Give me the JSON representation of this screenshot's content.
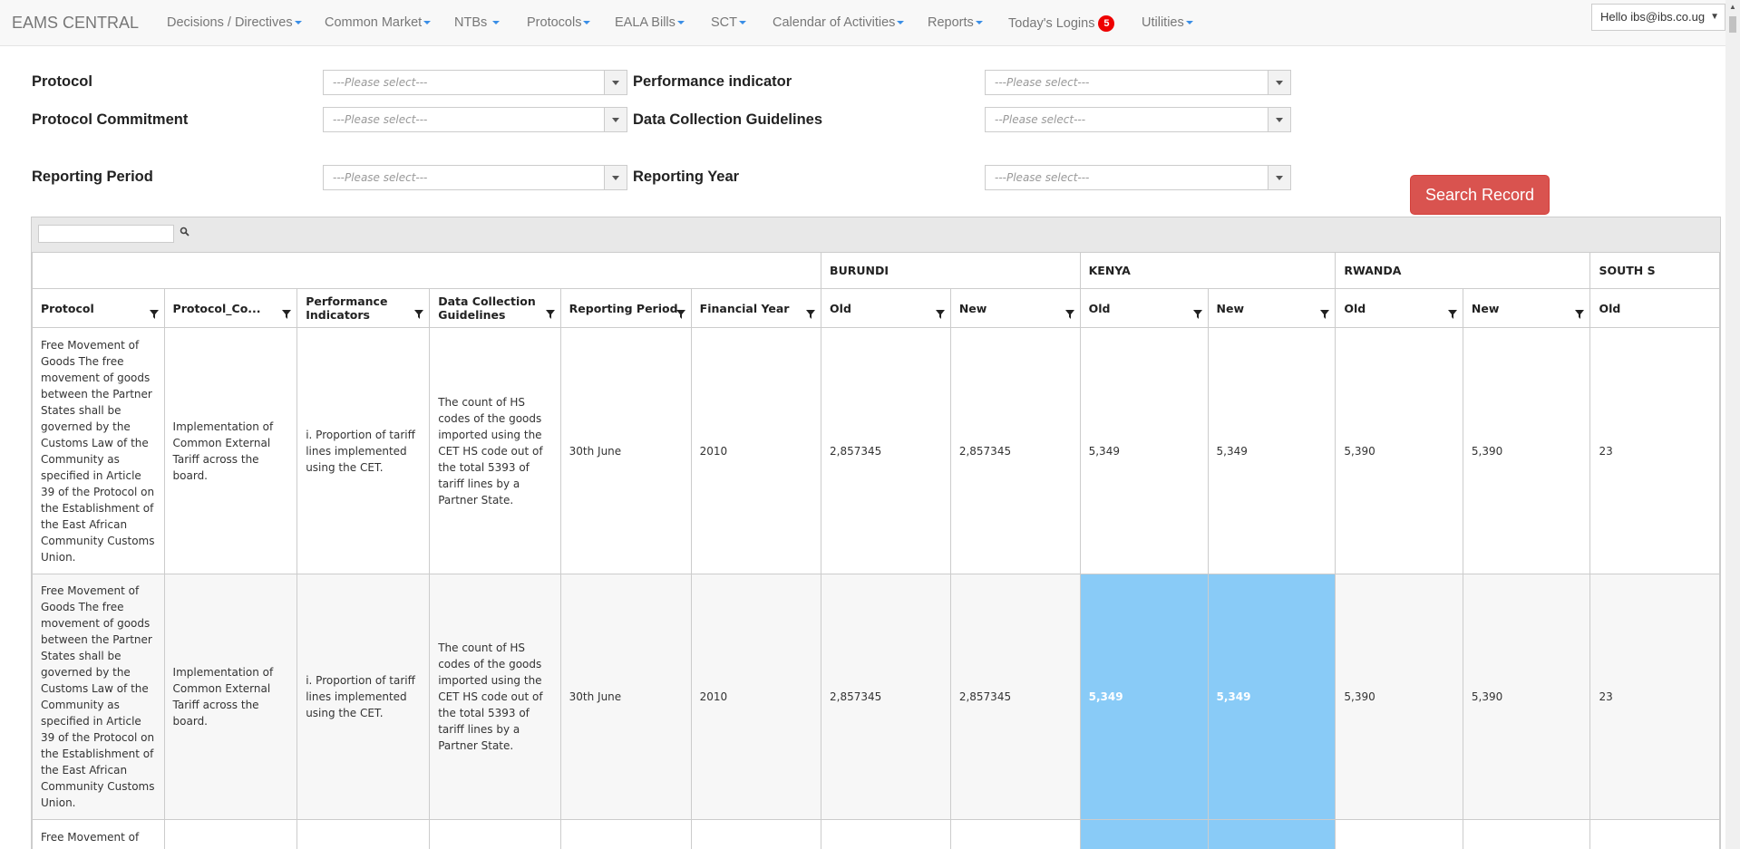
{
  "navbar": {
    "brand": "EAMS CENTRAL",
    "items": [
      {
        "label": "Decisions / Directives"
      },
      {
        "label": "Common Market"
      },
      {
        "label": "NTBs"
      },
      {
        "label": "Protocols"
      },
      {
        "label": "EALA Bills"
      },
      {
        "label": "SCT"
      },
      {
        "label": "Calendar of Activities"
      },
      {
        "label": "Reports"
      },
      {
        "label": "Today's Logins",
        "badge": "5"
      },
      {
        "label": "Utilities"
      }
    ],
    "user": "Hello ibs@ibs.co.ug"
  },
  "filters": {
    "protocol": {
      "label": "Protocol",
      "placeholder": "---Please select---"
    },
    "protocol_commitment": {
      "label": "Protocol Commitment",
      "placeholder": "---Please select---"
    },
    "reporting_period": {
      "label": "Reporting Period",
      "placeholder": "---Please select---"
    },
    "performance_indicator": {
      "label": "Performance indicator",
      "placeholder": "---Please select---"
    },
    "data_collection_guidelines": {
      "label": "Data Collection Guidelines",
      "placeholder": "--Please select---"
    },
    "reporting_year": {
      "label": "Reporting Year",
      "placeholder": "---Please select---"
    },
    "search_button": "Search Record"
  },
  "grid": {
    "countries": [
      "BURUNDI",
      "KENYA",
      "RWANDA",
      "SOUTH S"
    ],
    "columns": [
      "Protocol",
      "Protocol_Co...",
      "Performance Indicators",
      "Data Collection Guidelines",
      "Reporting Period",
      "Financial Year",
      "Old",
      "New",
      "Old",
      "New",
      "Old",
      "New",
      "Old"
    ],
    "rows": [
      {
        "protocol": "Free Movement of Goods The free movement of goods between the Partner States shall be governed by the Customs Law of the Community as specified in Article 39 of the Protocol on the Establishment of the East African Community Customs Union.",
        "commitment": "Implementation of Common External Tariff across the board.",
        "indicator": "i. Proportion of tariff lines implemented using the CET.",
        "guidelines": "The count of HS codes of the goods imported using the CET HS code out of the total 5393 of tariff lines by a Partner State.",
        "period": "30th June",
        "year": "2010",
        "burundi_old": "2,857345",
        "burundi_new": "2,857345",
        "kenya_old": "5,349",
        "kenya_new": "5,349",
        "rwanda_old": "5,390",
        "rwanda_new": "5,390",
        "south_old": "23"
      },
      {
        "protocol": "Free Movement of Goods The free movement of goods between the Partner States shall be governed by the Customs Law of the Community as specified in Article 39 of the Protocol on the Establishment of the East African Community Customs Union.",
        "commitment": "Implementation of Common External Tariff across the board.",
        "indicator": "i. Proportion of tariff lines implemented using the CET.",
        "guidelines": "The count of HS codes of the goods imported using the CET HS code out of the total 5393 of tariff lines by a Partner State.",
        "period": "30th June",
        "year": "2010",
        "burundi_old": "2,857345",
        "burundi_new": "2,857345",
        "kenya_old": "5,349",
        "kenya_new": "5,349",
        "rwanda_old": "5,390",
        "rwanda_new": "5,390",
        "south_old": "23"
      },
      {
        "protocol": "Free Movement of"
      }
    ]
  },
  "colors": {
    "highlight": "#89cbf7",
    "search_button": "#d9534f",
    "badge": "#ee0000"
  }
}
